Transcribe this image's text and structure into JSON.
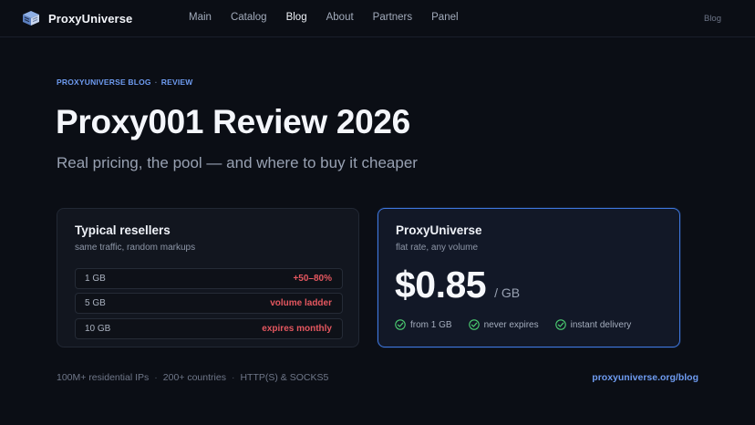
{
  "brand": {
    "name": "ProxyUniverse",
    "logo_icon": "proxy-logo-icon"
  },
  "nav": {
    "links": [
      {
        "label": "Main"
      },
      {
        "label": "Catalog"
      },
      {
        "label": "Blog",
        "active": true
      },
      {
        "label": "About"
      },
      {
        "label": "Partners"
      },
      {
        "label": "Panel"
      }
    ],
    "right_label": "Blog"
  },
  "hero": {
    "eyebrow_site": "PROXYUNIVERSE BLOG",
    "eyebrow_sep": "·",
    "eyebrow_section": "REVIEW",
    "title": "Proxy001 Review 2026",
    "subtitle": "Real pricing, the pool — and where to buy it cheaper"
  },
  "resellers_card": {
    "title": "Typical resellers",
    "subtitle": "same traffic, random markups",
    "rows": [
      {
        "amount": "1 GB",
        "note": "+50–80%"
      },
      {
        "amount": "5 GB",
        "note": "volume ladder"
      },
      {
        "amount": "10 GB",
        "note": "expires monthly"
      }
    ]
  },
  "proxyuniverse_card": {
    "title": "ProxyUniverse",
    "subtitle": "flat rate, any volume",
    "price": "$0.85",
    "unit": "/ GB",
    "features": [
      {
        "label": "from 1 GB",
        "icon": "check-circle-icon"
      },
      {
        "label": "never expires",
        "icon": "check-circle-icon"
      },
      {
        "label": "instant delivery",
        "icon": "check-circle-icon"
      }
    ]
  },
  "footer": {
    "stats": [
      "100M+ residential IPs",
      "200+ countries",
      "HTTP(S) & SOCKS5"
    ],
    "stats_sep": "·",
    "link": "proxyuniverse.org/blog"
  },
  "colors": {
    "background": "#0b0e15",
    "accent_blue": "#6e9bf0",
    "highlight_border": "#3f78e0",
    "markup_red": "#e4575f",
    "check_green": "#4ccf72"
  }
}
